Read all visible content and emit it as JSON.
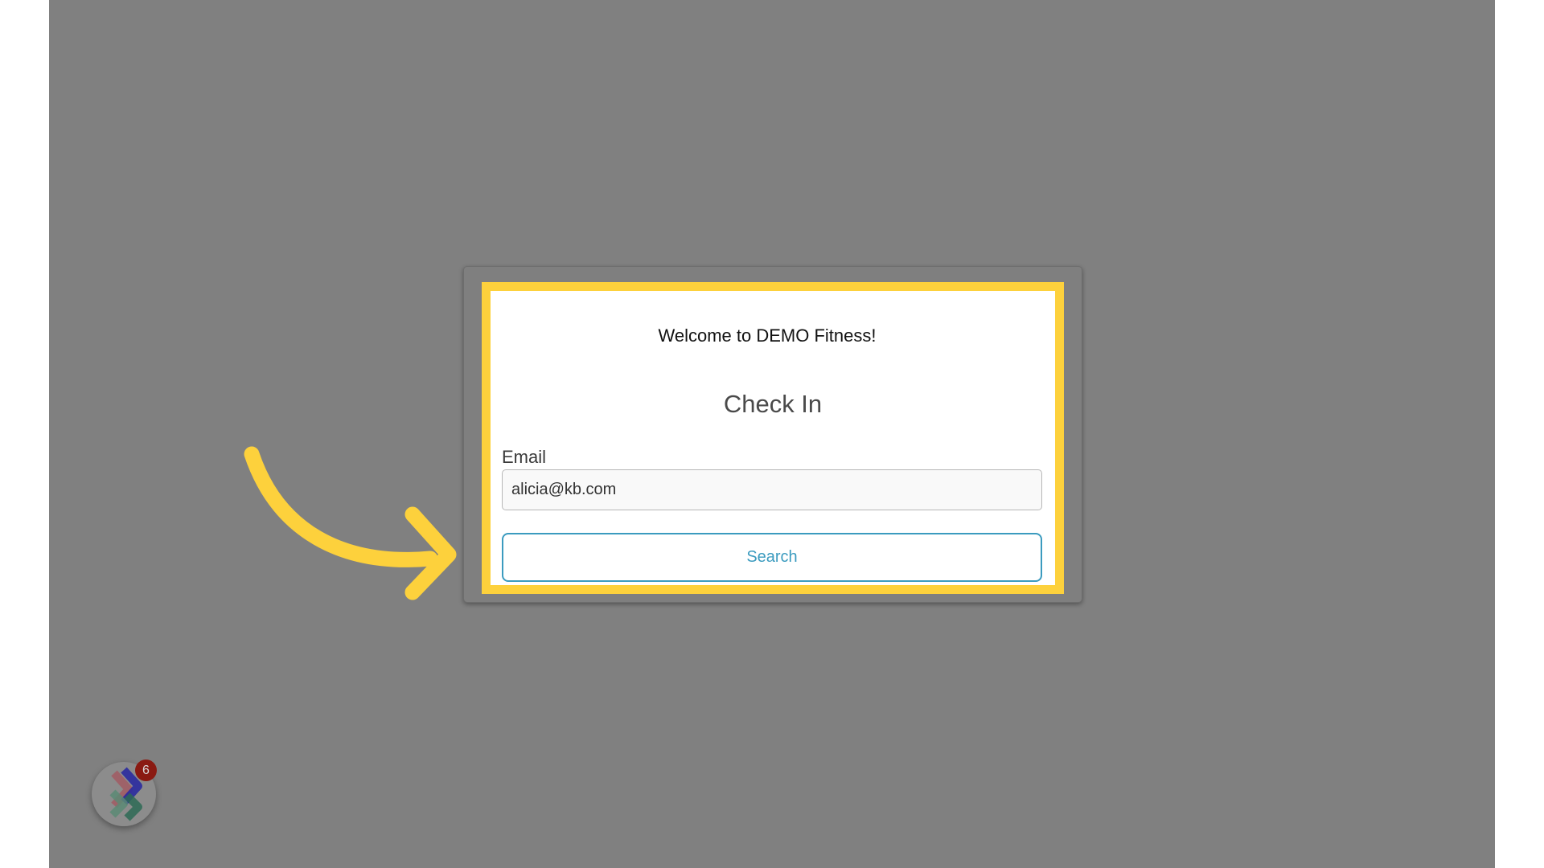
{
  "modal": {
    "welcome_text": "Welcome to DEMO Fitness!",
    "title": "Check In",
    "email_label": "Email",
    "email_value": "alicia@kb.com",
    "search_label": "Search"
  },
  "launcher": {
    "badge_count": "6",
    "icon": "chevron-stack-icon"
  },
  "annotation": {
    "icon": "curved-arrow-icon"
  },
  "colors": {
    "backdrop": "#808080",
    "highlight": "#fdd13c",
    "button_accent": "#3b9bbf",
    "badge": "#8a1a12"
  }
}
